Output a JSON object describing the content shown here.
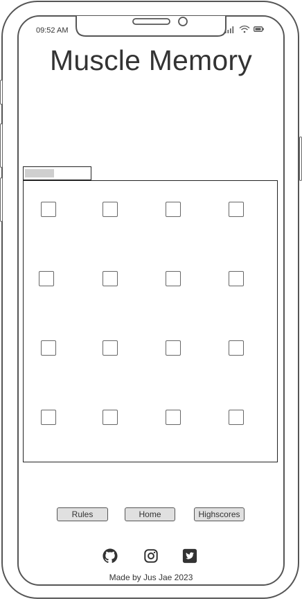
{
  "status_bar": {
    "time": "09:52 AM",
    "icons": [
      "signal-icon",
      "wifi-icon",
      "battery-icon"
    ]
  },
  "header": {
    "title": "Muscle Memory"
  },
  "progress": {
    "fraction": 0.45
  },
  "board": {
    "rows": 4,
    "cols": 4
  },
  "nav": {
    "rules_label": "Rules",
    "home_label": "Home",
    "highscores_label": "Highscores"
  },
  "social": {
    "icons": [
      "github-icon",
      "instagram-icon",
      "twitter-icon"
    ]
  },
  "footer": {
    "credit": "Made by Jus Jae 2023"
  },
  "colors": {
    "outline": "#555555",
    "text": "#333333",
    "button_fill": "#e0e0e0",
    "progress_fill": "#cfcfcf"
  }
}
